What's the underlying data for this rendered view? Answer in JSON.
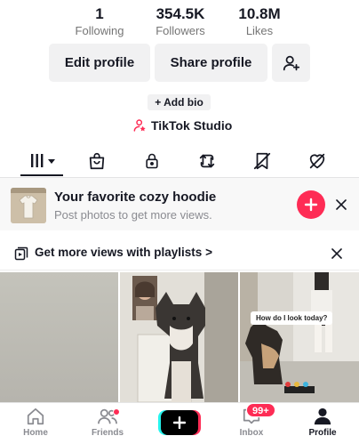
{
  "stats": [
    {
      "value": "1",
      "label": "Following"
    },
    {
      "value": "354.5K",
      "label": "Followers"
    },
    {
      "value": "10.8M",
      "label": "Likes"
    }
  ],
  "buttons": {
    "edit_profile": "Edit profile",
    "share_profile": "Share profile",
    "add_friend_icon": "add-person-icon"
  },
  "add_bio": "+ Add bio",
  "studio": {
    "label": "TikTok Studio",
    "icon": "studio-person-icon",
    "accent": "#fe2c55"
  },
  "tabs": [
    {
      "icon": "grid-icon",
      "active": true
    },
    {
      "icon": "shop-bag-icon"
    },
    {
      "icon": "lock-icon"
    },
    {
      "icon": "repost-icon"
    },
    {
      "icon": "favorites-icon"
    },
    {
      "icon": "liked-heart-icon"
    }
  ],
  "promo_card": {
    "title": "Your favorite cozy hoodie",
    "subtitle": "Post photos to get more views.",
    "accent": "#fe2c55"
  },
  "playlist_banner": {
    "text": "Get more views with playlists",
    "chevron": ">"
  },
  "videos": [
    {
      "caption": ""
    },
    {
      "caption": ""
    },
    {
      "caption": "How do I look today?"
    }
  ],
  "nav": {
    "home": "Home",
    "friends": "Friends",
    "inbox": "Inbox",
    "inbox_badge": "99+",
    "profile": "Profile"
  }
}
